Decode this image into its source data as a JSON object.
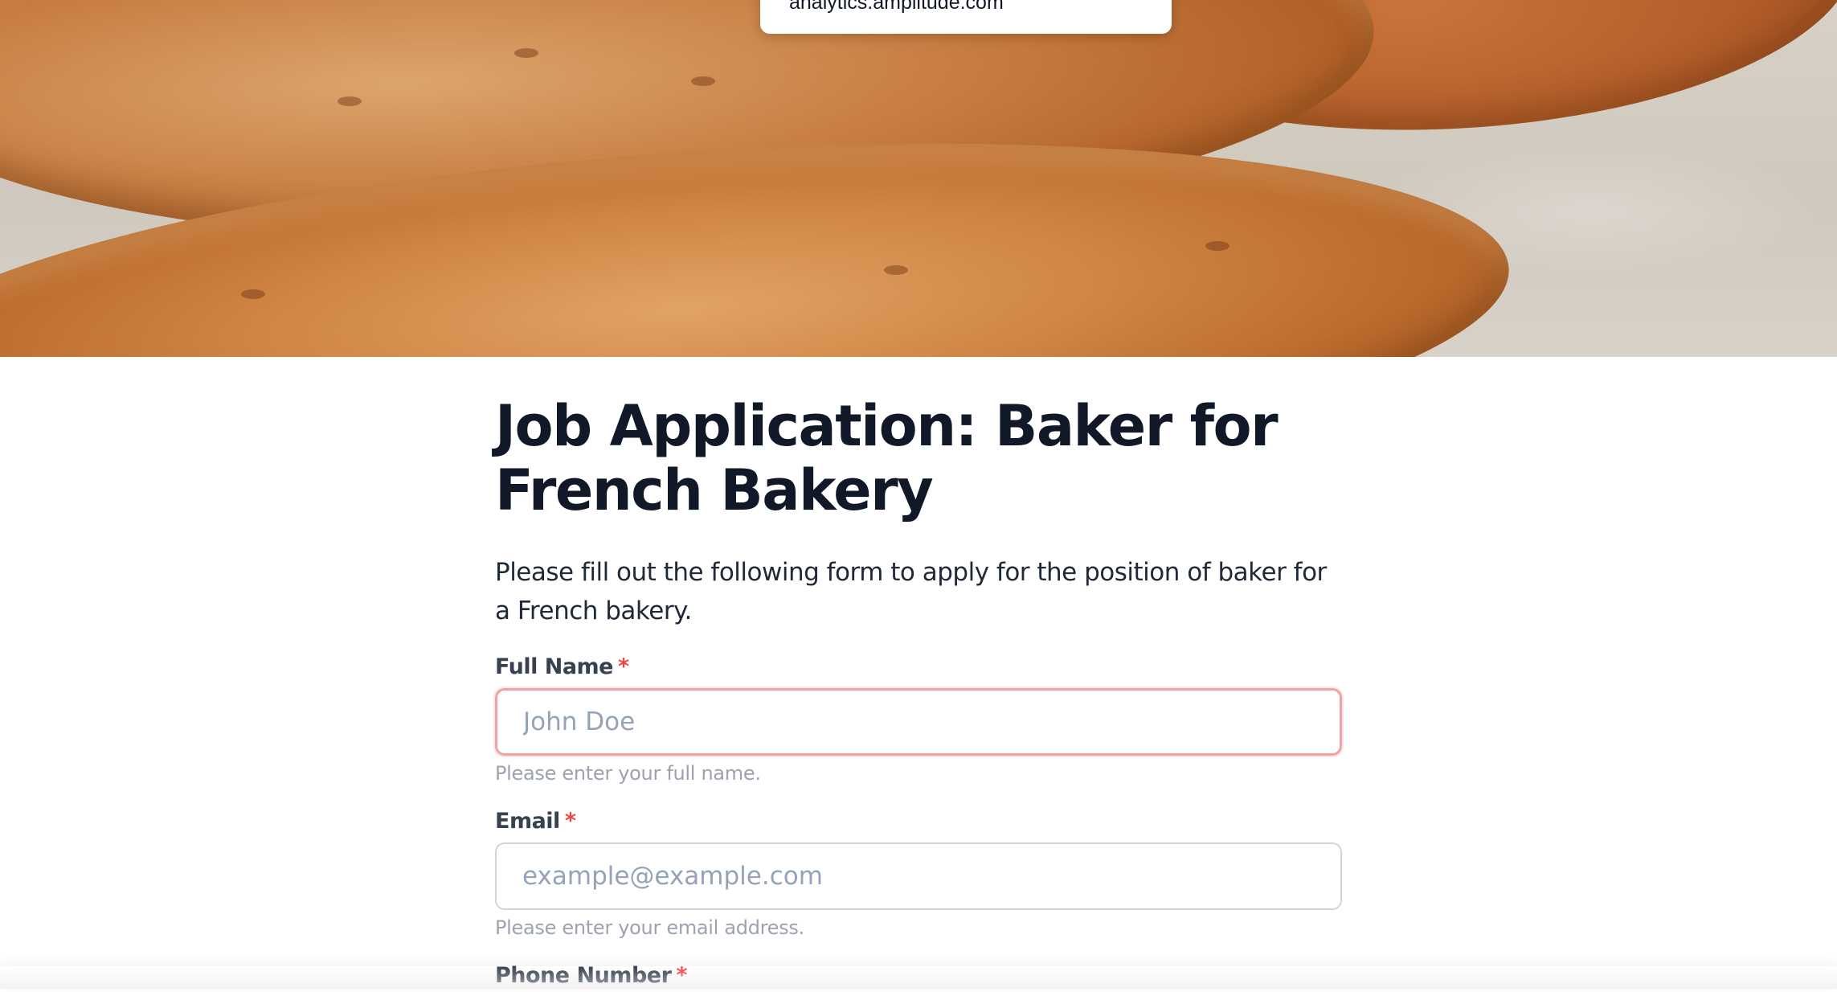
{
  "tooltip": {
    "text": "analytics.amplitude.com"
  },
  "form": {
    "title": "Job Application: Baker for French Bakery",
    "description": "Please fill out the following form to apply for the position of baker for a French bakery.",
    "required_marker": "*",
    "fields": [
      {
        "label": "Full Name",
        "placeholder": "John Doe",
        "value": "",
        "help": "Please enter your full name.",
        "state": "error"
      },
      {
        "label": "Email",
        "placeholder": "example@example.com",
        "value": "",
        "help": "Please enter your email address.",
        "state": "default"
      },
      {
        "label": "Phone Number"
      }
    ]
  },
  "colors": {
    "title": "#111827",
    "required": "#ef4444",
    "error_border": "#f1a3a3",
    "input_border": "#d1d5db",
    "placeholder": "#94a3b8",
    "help_text": "#9ca3af"
  }
}
